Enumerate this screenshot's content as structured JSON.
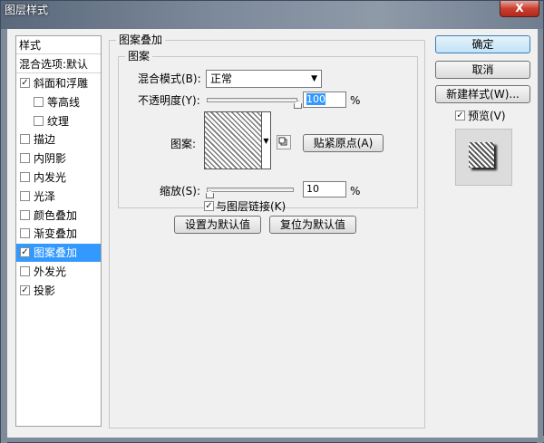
{
  "window": {
    "title": "图层样式",
    "close_glyph": "X"
  },
  "styles": {
    "header_label": "样式",
    "blend_options_label": "混合选项:默认",
    "items": [
      {
        "label": "斜面和浮雕",
        "checked": "✓",
        "indent": false,
        "selected": false
      },
      {
        "label": "等高线",
        "checked": "",
        "indent": true,
        "selected": false
      },
      {
        "label": "纹理",
        "checked": "",
        "indent": true,
        "selected": false
      },
      {
        "label": "描边",
        "checked": "",
        "indent": false,
        "selected": false
      },
      {
        "label": "内阴影",
        "checked": "",
        "indent": false,
        "selected": false
      },
      {
        "label": "内发光",
        "checked": "",
        "indent": false,
        "selected": false
      },
      {
        "label": "光泽",
        "checked": "",
        "indent": false,
        "selected": false
      },
      {
        "label": "颜色叠加",
        "checked": "",
        "indent": false,
        "selected": false
      },
      {
        "label": "渐变叠加",
        "checked": "",
        "indent": false,
        "selected": false
      },
      {
        "label": "图案叠加",
        "checked": "✓",
        "indent": false,
        "selected": true
      },
      {
        "label": "外发光",
        "checked": "",
        "indent": false,
        "selected": false
      },
      {
        "label": "投影",
        "checked": "✓",
        "indent": false,
        "selected": false
      }
    ]
  },
  "pattern_overlay": {
    "group_title": "图案叠加",
    "sub_group_title": "图案",
    "blend_mode_label": "混合模式(B):",
    "blend_mode_value": "正常",
    "opacity_label": "不透明度(Y):",
    "opacity_value": "100",
    "opacity_level": 1.0,
    "percent_sign": "%",
    "pattern_label": "图案:",
    "snap_origin_label": "贴紧原点(A)",
    "scale_label": "缩放(S):",
    "scale_value": "10",
    "scale_level": 0.0,
    "link_label": "与图层链接(K)",
    "link_checked": "✓",
    "make_default_label": "设置为默认值",
    "reset_default_label": "复位为默认值"
  },
  "actions": {
    "ok_label": "确定",
    "cancel_label": "取消",
    "new_style_label": "新建样式(W)...",
    "preview_label": "预览(V)",
    "preview_checked": "✓"
  }
}
